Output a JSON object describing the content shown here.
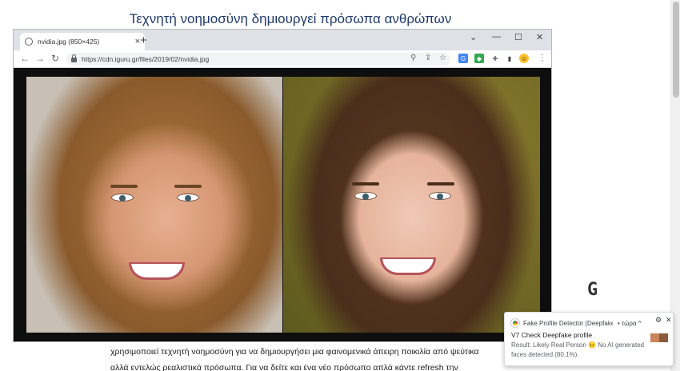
{
  "article": {
    "title": "Τεχνητή νοημοσύνη δημιουργεί πρόσωπα ανθρώπων",
    "body_line1": "χρησιμοποιεί τεχνητή νοημοσύνη για να δημιουργήσει μια φαινομενικά άπειρη ποικιλία από ψεύτικα",
    "body_line2": "αλλά εντελώς ρεαλιστικά πρόσωπα. Για να δείτε και ένα νέο πρόσωπο απλά κάντε refresh την"
  },
  "browser": {
    "tab_title": "nvidia.jpg (850×425)",
    "tab_close": "×",
    "new_tab": "+",
    "url": "https://cdn.iguru.gr/files/2019/02/nvidia.jpg",
    "controls": {
      "chevron": "⌄",
      "minimize": "—",
      "maximize": "☐",
      "close": "✕"
    },
    "nav": {
      "back": "←",
      "forward": "→",
      "reload": "↻"
    },
    "toolbar_icons": [
      "zoom-icon",
      "share-icon",
      "bookmark-star-icon",
      "translate-icon",
      "shield-icon",
      "puzzle-icon",
      "sidepanel-icon",
      "emoji-icon",
      "menu-icon"
    ],
    "toolbar_glyphs": {
      "zoom": "⚲",
      "share": "⇪",
      "star": "☆",
      "translate": "G",
      "shield": "◆",
      "puzzle": "✚",
      "sidepanel": "▮",
      "emoji": "☺",
      "menu": "⋮"
    }
  },
  "watermark": "G",
  "notification": {
    "source": "Fake Profile Detector (Deepfake,...",
    "time": "• τώρα ^",
    "gear": "⚙",
    "close": "✕",
    "title": "V7 Check Deepfake profile",
    "body_prefix": "Result: Likely Real Person",
    "body_emoji": "😐",
    "body_suffix": "No AI generated faces detected (80.1%)."
  },
  "colors": {
    "title": "#1f3a6b",
    "tabstrip": "#dee1e6",
    "accent": "#1a73e8"
  }
}
